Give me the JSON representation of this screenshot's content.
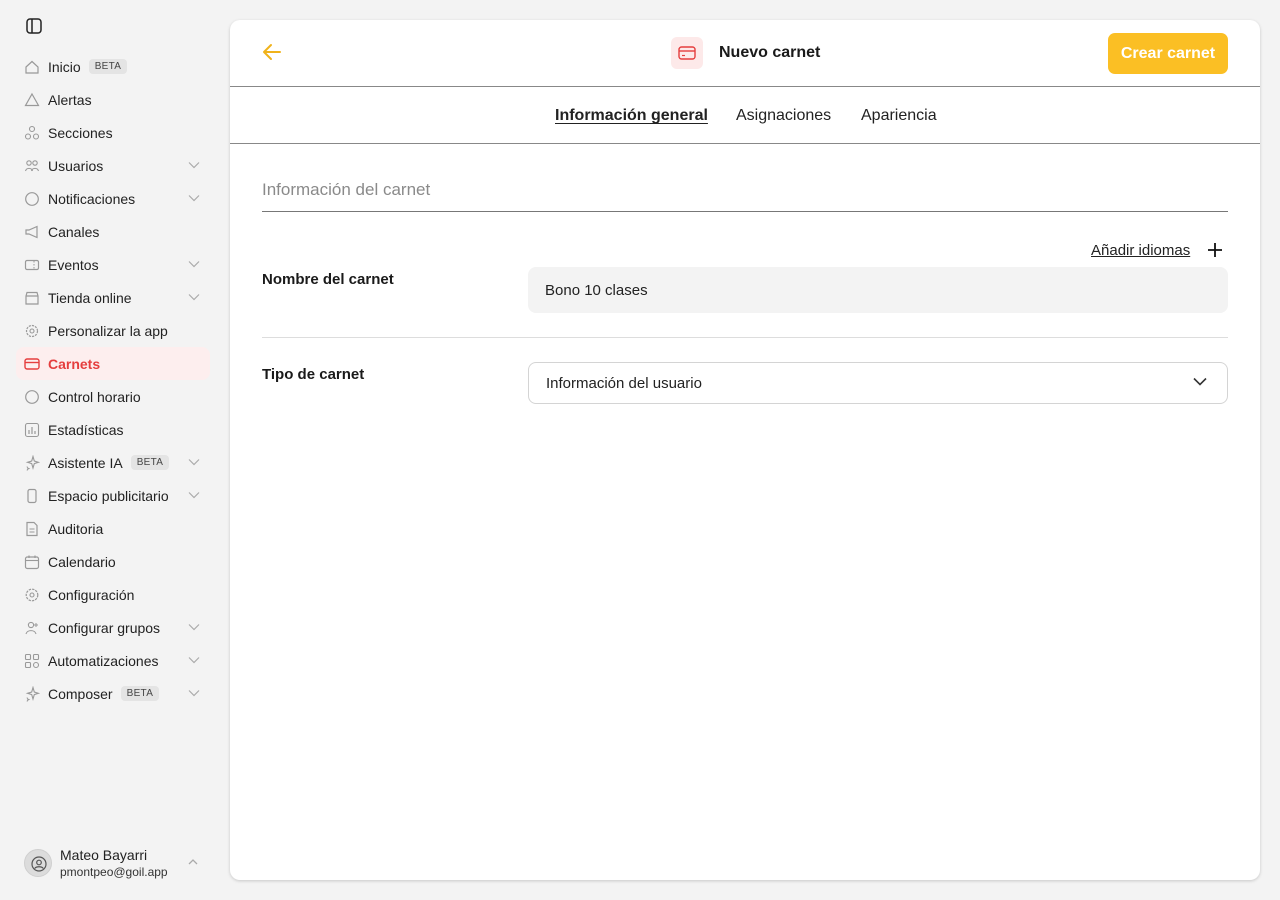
{
  "sidebar": {
    "items": [
      {
        "label": "Inicio",
        "badge": "BETA",
        "icon": "home-icon"
      },
      {
        "label": "Alertas",
        "icon": "alert-triangle-icon"
      },
      {
        "label": "Secciones",
        "icon": "sections-icon"
      },
      {
        "label": "Usuarios",
        "icon": "users-icon",
        "expandable": true
      },
      {
        "label": "Notificaciones",
        "icon": "message-icon",
        "expandable": true
      },
      {
        "label": "Canales",
        "icon": "megaphone-icon"
      },
      {
        "label": "Eventos",
        "icon": "ticket-icon",
        "expandable": true
      },
      {
        "label": "Tienda online",
        "icon": "store-icon",
        "expandable": true
      },
      {
        "label": "Personalizar la app",
        "icon": "gear-icon"
      },
      {
        "label": "Carnets",
        "icon": "card-icon",
        "active": true
      },
      {
        "label": "Control horario",
        "icon": "clock-icon"
      },
      {
        "label": "Estadísticas",
        "icon": "chart-icon"
      },
      {
        "label": "Asistente IA",
        "badge": "BETA",
        "icon": "sparkle-icon",
        "expandable": true
      },
      {
        "label": "Espacio publicitario",
        "icon": "phone-icon",
        "expandable": true
      },
      {
        "label": "Auditoria",
        "icon": "document-icon"
      },
      {
        "label": "Calendario",
        "icon": "calendar-icon"
      },
      {
        "label": "Configuración",
        "icon": "settings-icon"
      },
      {
        "label": "Configurar grupos",
        "icon": "user-group-icon",
        "expandable": true
      },
      {
        "label": "Automatizaciones",
        "icon": "workflow-icon",
        "expandable": true
      },
      {
        "label": "Composer",
        "badge": "BETA",
        "icon": "sparkle-icon",
        "expandable": true
      }
    ],
    "user": {
      "name": "Mateo Bayarri",
      "email": "pmontpeo@goil.app"
    }
  },
  "header": {
    "title": "Nuevo carnet",
    "create_label": "Crear carnet"
  },
  "tabs": [
    {
      "label": "Información general",
      "active": true
    },
    {
      "label": "Asignaciones"
    },
    {
      "label": "Apariencia"
    }
  ],
  "form": {
    "section_title": "Información del carnet",
    "add_languages": "Añadir idiomas",
    "name_label": "Nombre del carnet",
    "name_value": "Bono 10 clases",
    "type_label": "Tipo de carnet",
    "type_value": "Información del usuario"
  },
  "colors": {
    "accent": "#fbbf24",
    "active_nav": "#e53e3e",
    "active_nav_bg": "#fdeeee"
  }
}
